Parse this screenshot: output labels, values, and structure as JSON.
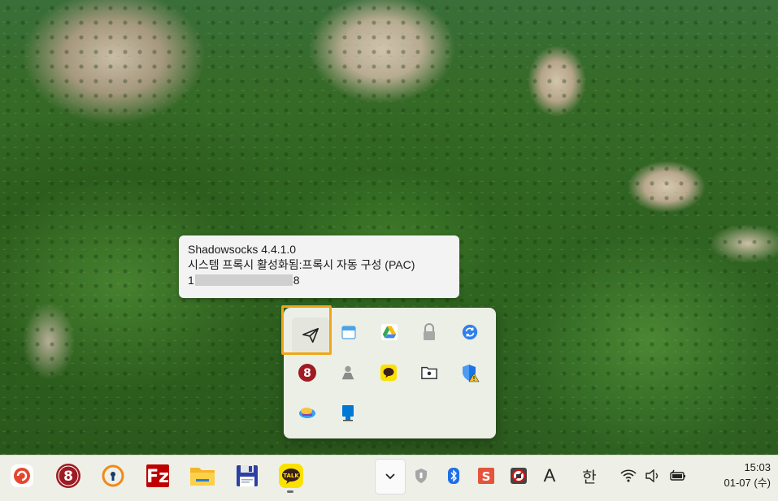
{
  "tooltip": {
    "line1": "Shadowsocks 4.4.1.0",
    "line2": "시스템 프록시 활성화됨:프록시 자동 구성 (PAC)",
    "line3_prefix": "1",
    "line3_suffix": "8"
  },
  "tray_icons": [
    {
      "name": "shadowsocks-icon",
      "selected": true
    },
    {
      "name": "calendar-icon"
    },
    {
      "name": "google-drive-icon"
    },
    {
      "name": "lock-icon"
    },
    {
      "name": "sync-icon"
    },
    {
      "name": "korean-app-icon"
    },
    {
      "name": "user-icon"
    },
    {
      "name": "kakaotalk-icon"
    },
    {
      "name": "folder-icon"
    },
    {
      "name": "windows-security-warning-icon"
    },
    {
      "name": "paint-app-icon"
    },
    {
      "name": "blue-app-icon"
    }
  ],
  "taskbar": {
    "pinned": [
      "swirl-app-icon",
      "korean-app-icon",
      "keyhole-icon",
      "filezilla-icon",
      "file-explorer-icon",
      "save-disk-icon",
      "kakaotalk-icon"
    ],
    "system": {
      "ime_letter": "A",
      "ime_korean": "한"
    },
    "clock": {
      "time": "15:03",
      "date": "01-07 (수)"
    }
  },
  "colors": {
    "highlight": "#f0a616",
    "taskbar_bg": "#eef0e7"
  }
}
